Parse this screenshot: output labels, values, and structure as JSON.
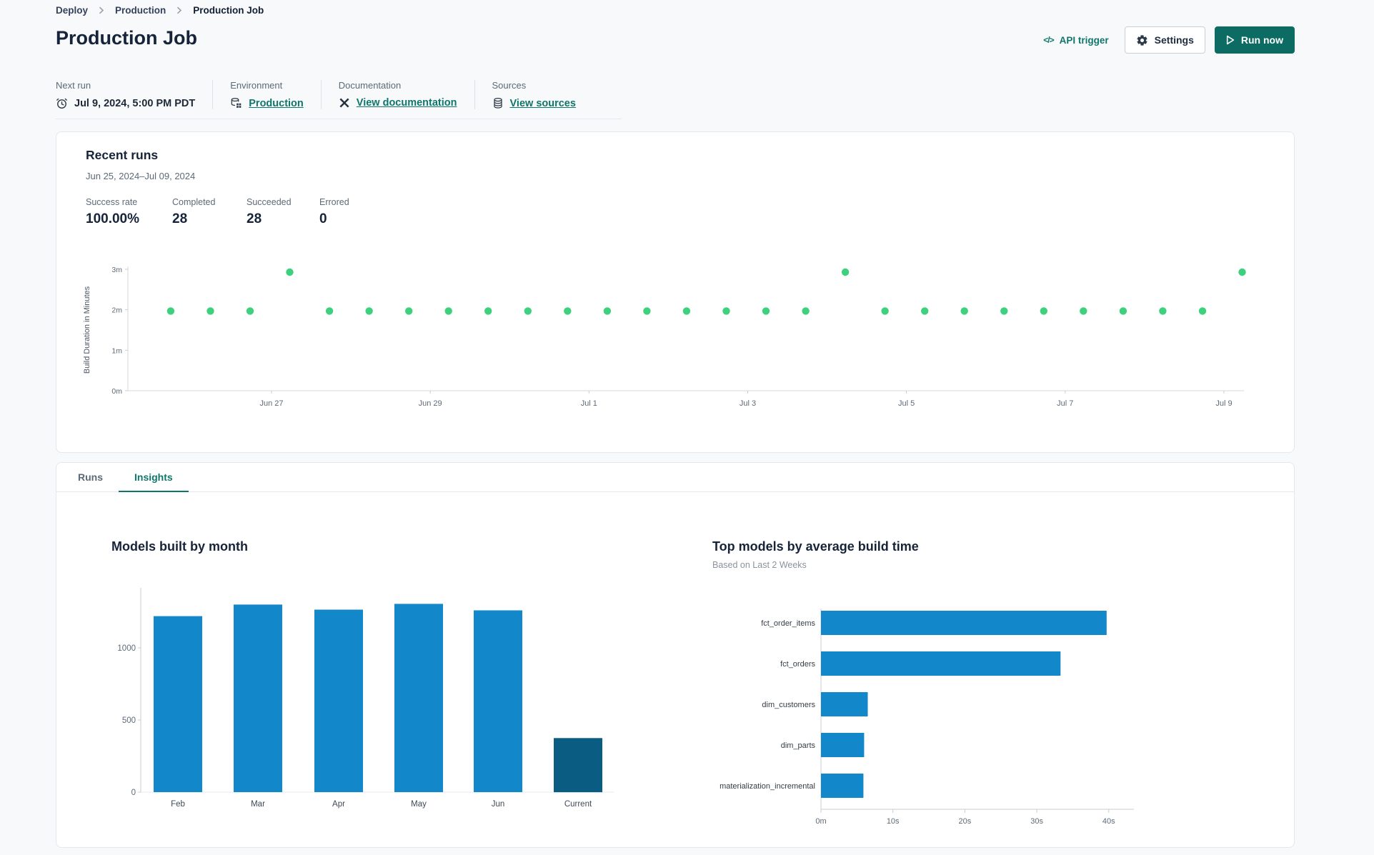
{
  "breadcrumb": {
    "items": [
      {
        "label": "Deploy"
      },
      {
        "label": "Production"
      },
      {
        "label": "Production Job"
      }
    ]
  },
  "header": {
    "title": "Production Job",
    "actions": {
      "api_code_glyph": "</>",
      "api_trigger": "API trigger",
      "settings": "Settings",
      "run_now": "Run now"
    }
  },
  "info_bar": {
    "next_run": {
      "label": "Next run",
      "value": "Jul 9, 2024, 5:00 PM PDT"
    },
    "environment": {
      "label": "Environment",
      "value": "Production"
    },
    "documentation": {
      "label": "Documentation",
      "value": "View documentation"
    },
    "sources": {
      "label": "Sources",
      "value": "View sources"
    }
  },
  "recent_runs": {
    "title": "Recent runs",
    "date_range": "Jun 25, 2024–Jul 09, 2024",
    "stats": [
      {
        "label": "Success rate",
        "value": "100.00%"
      },
      {
        "label": "Completed",
        "value": "28"
      },
      {
        "label": "Succeeded",
        "value": "28"
      },
      {
        "label": "Errored",
        "value": "0"
      }
    ]
  },
  "tabs": [
    {
      "label": "Runs",
      "active": false
    },
    {
      "label": "Insights",
      "active": true
    }
  ],
  "colors": {
    "accent_teal": "#0c6b62",
    "link_teal": "#0f766b",
    "dot_green": "#3ed17d",
    "bar_blue": "#1287c9",
    "bar_dark_blue": "#0b5c82",
    "text_dark": "#16243a",
    "text_gray": "#5d6a77",
    "axis_line": "#d6dade"
  },
  "chart_data": [
    {
      "id": "build-duration-scatter",
      "type": "scatter",
      "ylabel": "Build Duration in Minutes",
      "ylim": [
        0,
        3.18
      ],
      "yticks": [
        {
          "v": 0,
          "label": "0m"
        },
        {
          "v": 1,
          "label": "1m"
        },
        {
          "v": 2,
          "label": "2m"
        },
        {
          "v": 3,
          "label": "3m"
        }
      ],
      "xticks": [
        {
          "day": 2,
          "label": "Jun 27"
        },
        {
          "day": 4,
          "label": "Jun 29"
        },
        {
          "day": 6,
          "label": "Jul 1"
        },
        {
          "day": 8,
          "label": "Jul 3"
        },
        {
          "day": 10,
          "label": "Jul 5"
        },
        {
          "day": 12,
          "label": "Jul 7"
        },
        {
          "day": 14,
          "label": "Jul 9"
        }
      ],
      "points": [
        {
          "day": 0.73,
          "minutes": 1.97
        },
        {
          "day": 1.23,
          "minutes": 1.97
        },
        {
          "day": 1.73,
          "minutes": 1.97
        },
        {
          "day": 2.23,
          "minutes": 2.93
        },
        {
          "day": 2.73,
          "minutes": 1.97
        },
        {
          "day": 3.23,
          "minutes": 1.97
        },
        {
          "day": 3.73,
          "minutes": 1.97
        },
        {
          "day": 4.23,
          "minutes": 1.97
        },
        {
          "day": 4.73,
          "minutes": 1.97
        },
        {
          "day": 5.23,
          "minutes": 1.97
        },
        {
          "day": 5.73,
          "minutes": 1.97
        },
        {
          "day": 6.23,
          "minutes": 1.97
        },
        {
          "day": 6.73,
          "minutes": 1.97
        },
        {
          "day": 7.23,
          "minutes": 1.97
        },
        {
          "day": 7.73,
          "minutes": 1.97
        },
        {
          "day": 8.23,
          "minutes": 1.97
        },
        {
          "day": 8.73,
          "minutes": 1.97
        },
        {
          "day": 9.23,
          "minutes": 2.93
        },
        {
          "day": 9.73,
          "minutes": 1.97
        },
        {
          "day": 10.23,
          "minutes": 1.97
        },
        {
          "day": 10.73,
          "minutes": 1.97
        },
        {
          "day": 11.23,
          "minutes": 1.97
        },
        {
          "day": 11.73,
          "minutes": 1.97
        },
        {
          "day": 12.23,
          "minutes": 1.97
        },
        {
          "day": 12.73,
          "minutes": 1.97
        },
        {
          "day": 13.23,
          "minutes": 1.97
        },
        {
          "day": 13.73,
          "minutes": 1.97
        },
        {
          "day": 14.23,
          "minutes": 2.93
        }
      ]
    },
    {
      "id": "models-by-month",
      "type": "bar",
      "title": "Models built by month",
      "categories": [
        "Feb",
        "Mar",
        "Apr",
        "May",
        "Jun",
        "Current"
      ],
      "values": [
        1220,
        1300,
        1265,
        1305,
        1260,
        375
      ],
      "yticks": [
        0,
        500,
        1000
      ],
      "ylim": [
        0,
        1415
      ],
      "highlight_last": true
    },
    {
      "id": "top-models-by-build-time",
      "type": "bar-horizontal",
      "title": "Top models by average build time",
      "subtitle": "Based on Last 2 Weeks",
      "categories": [
        "fct_order_items",
        "fct_orders",
        "dim_customers",
        "dim_parts",
        "materialization_incremental"
      ],
      "values_seconds": [
        39.7,
        33.3,
        6.5,
        6.0,
        5.9
      ],
      "xticks": [
        {
          "v": 0,
          "label": "0m"
        },
        {
          "v": 10,
          "label": "10s"
        },
        {
          "v": 20,
          "label": "20s"
        },
        {
          "v": 30,
          "label": "30s"
        },
        {
          "v": 40,
          "label": "40s"
        }
      ],
      "xlim": [
        0,
        43.5
      ]
    }
  ]
}
